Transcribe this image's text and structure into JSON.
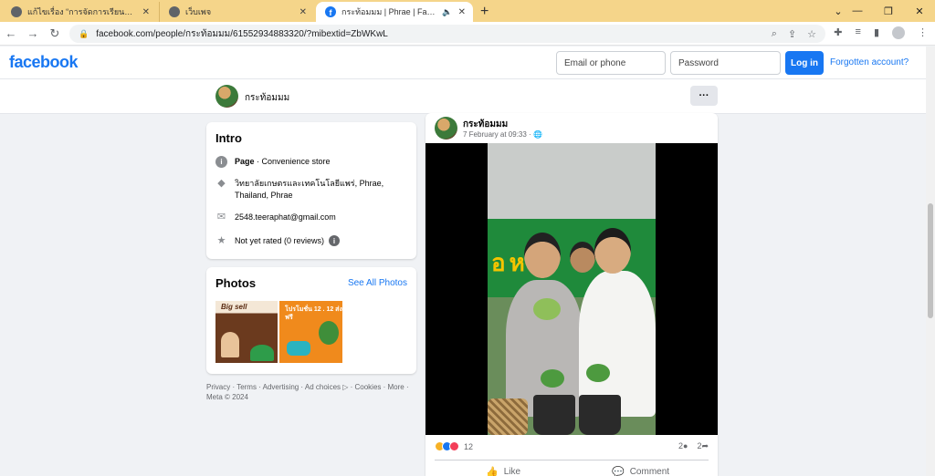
{
  "browser": {
    "tabs": [
      {
        "title": "แก้ไขเรื่อง “การจัดการเรียนการสอน วิช",
        "active": false
      },
      {
        "title": "เว็บเพจ",
        "active": false
      },
      {
        "title": "กระท้อมมม | Phrae | Facebook",
        "active": true
      }
    ],
    "url": "facebook.com/people/กระท้อมมม/61552934883320/?mibextid=ZbWKwL",
    "new_tab": "+",
    "close": "✕"
  },
  "fb_header": {
    "logo": "facebook",
    "email_placeholder": "Email or phone",
    "password_placeholder": "Password",
    "login_label": "Log in",
    "forgot_label": "Forgotten account?"
  },
  "profile_bar": {
    "name": "กระท้อมมม",
    "more_label": "···"
  },
  "intro": {
    "title": "Intro",
    "page_label": "Page",
    "category": " · Convenience store",
    "address": "วิทยาลัยเกษตรและเทคโนโลยีแพร่, Phrae, Thailand, Phrae",
    "email": "2548.teeraphat@gmail.com",
    "rating": "Not yet rated (0 reviews)"
  },
  "photos": {
    "title": "Photos",
    "see_all": "See All Photos",
    "thumb1_text": "Big sell",
    "thumb2_text": "โปรโมชั่น 12 . 12 ส่งฟรี"
  },
  "footer": {
    "text": "Privacy · Terms · Advertising · Ad choices ▷ · Cookies · More · Meta © 2024"
  },
  "post": {
    "author": "กระท้อมมม",
    "time": "7 February at 09:33 · ",
    "reaction_count": "12",
    "comment_count": "2",
    "share_count": "2",
    "like_label": "Like",
    "comment_label": "Comment"
  },
  "colors": {
    "brand": "#1877f2",
    "tabstrip": "#f5d58a",
    "page_bg": "#f0f2f5"
  }
}
